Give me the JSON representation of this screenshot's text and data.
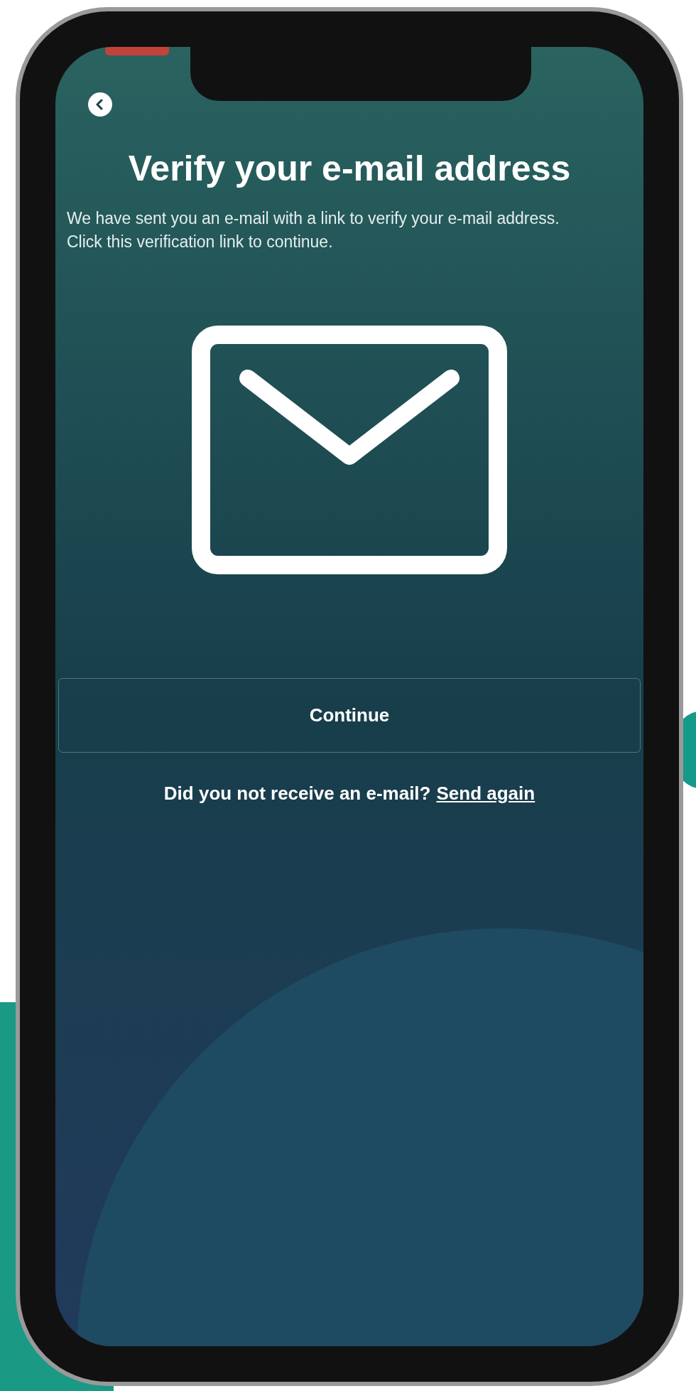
{
  "screen": {
    "title": "Verify your e-mail address",
    "message": "We have sent you an e-mail with a link to verify your e-mail address. Click this verification link to continue.",
    "primary_button": "Continue",
    "resend": {
      "prompt": "Did you not receive an e-mail?",
      "link": "Send again"
    }
  }
}
